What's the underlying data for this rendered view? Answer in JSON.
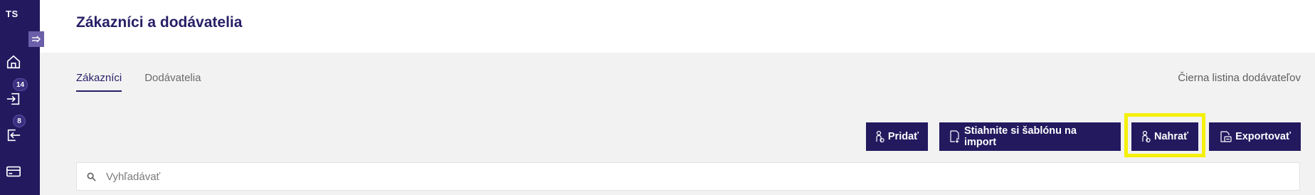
{
  "sidebar": {
    "logo": "TS",
    "items": [
      {
        "icon": "home-icon"
      },
      {
        "icon": "incoming-icon",
        "badge": "14"
      },
      {
        "icon": "outgoing-icon",
        "badge": "8"
      },
      {
        "icon": "card-icon"
      }
    ]
  },
  "header": {
    "title": "Zákazníci a dodávatelia"
  },
  "tabs": [
    {
      "label": "Zákazníci",
      "active": true
    },
    {
      "label": "Dodávatelia",
      "active": false
    }
  ],
  "blacklist_link": "Čierna listina dodávateľov",
  "toolbar": {
    "add_label": "Pridať",
    "template_label": "Stiahnite si šablónu na import",
    "upload_label": "Nahrať",
    "export_label": "Exportovať"
  },
  "search": {
    "placeholder": "Vyhľadávať",
    "value": ""
  },
  "colors": {
    "primary": "#23195f",
    "highlight": "#f5f00a",
    "background": "#f2f2f2"
  }
}
